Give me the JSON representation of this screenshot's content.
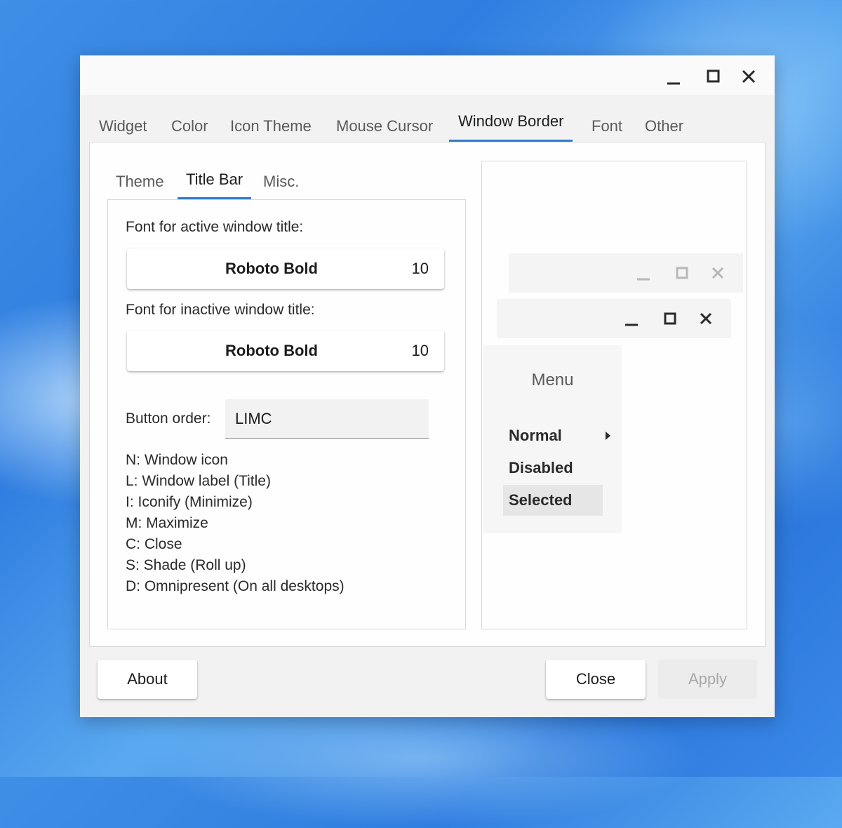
{
  "window": {
    "controls": [
      {
        "name": "minimize-icon"
      },
      {
        "name": "maximize-icon"
      },
      {
        "name": "close-icon"
      }
    ]
  },
  "tabs": [
    "Widget",
    "Color",
    "Icon Theme",
    "Mouse Cursor",
    "Window Border",
    "Font",
    "Other"
  ],
  "active_tab": "Window Border",
  "subtabs": [
    "Theme",
    "Title Bar",
    "Misc."
  ],
  "active_subtab": "Title Bar",
  "title_bar": {
    "active_font_label": "Font for active window title:",
    "active_font_name": "Roboto Bold",
    "active_font_size": "10",
    "inactive_font_label": "Font for inactive window title:",
    "inactive_font_name": "Roboto Bold",
    "inactive_font_size": "10",
    "button_order_label": "Button order:",
    "button_order_value": "LIMC",
    "legend": [
      "N: Window icon",
      "L: Window label (Title)",
      "I: Iconify (Minimize)",
      "M: Maximize",
      "C: Close",
      "S: Shade (Roll up)",
      "D: Omnipresent (On all desktops)"
    ]
  },
  "preview": {
    "menu_title": "Menu",
    "menu_items": [
      "Normal",
      "Disabled",
      "Selected"
    ]
  },
  "buttons": {
    "about": "About",
    "close": "Close",
    "apply": "Apply"
  },
  "colors": {
    "accent": "#2d7dd2",
    "window_bg": "#f2f2f2",
    "disabled_text": "#a8a8a8"
  }
}
